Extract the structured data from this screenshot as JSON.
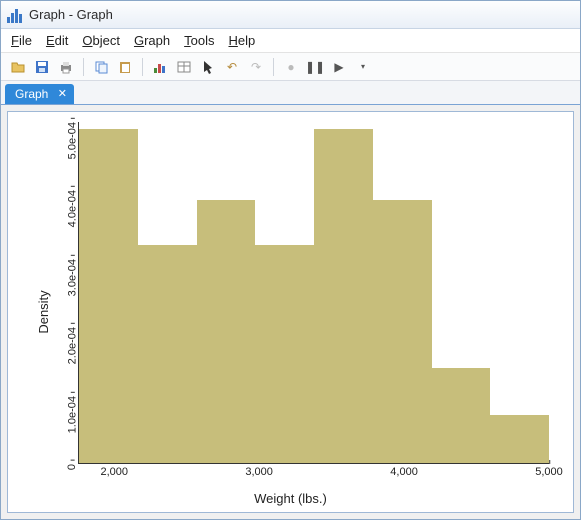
{
  "window": {
    "title": "Graph - Graph"
  },
  "menu": {
    "file": "File",
    "edit": "Edit",
    "object": "Object",
    "graph": "Graph",
    "tools": "Tools",
    "help": "Help"
  },
  "tab": {
    "label": "Graph"
  },
  "chart_data": {
    "type": "bar",
    "subtype": "histogram",
    "xlabel": "Weight (lbs.)",
    "ylabel": "Density",
    "bin_width": 500,
    "bin_edges": [
      1750,
      2250,
      2750,
      3250,
      3750,
      4250,
      4750,
      5250
    ],
    "categories": [
      "1750–2250",
      "2250–2750",
      "2750–3250",
      "3250–3750",
      "3750–4250",
      "4250–4750",
      "4750–5250"
    ],
    "values": [
      0.00049,
      0.00032,
      0.000385,
      0.00032,
      0.00049,
      0.000385,
      0.00014,
      7e-05
    ],
    "note_values_mapping": "values correspond to bin_edges lefts; 8 bars shown spanning the 7 edge pairs with extra leading bin at 1750",
    "ylim": [
      0,
      0.0005
    ],
    "yticks": [
      0,
      0.0001,
      0.0002,
      0.0003,
      0.0004,
      0.0005
    ],
    "ytick_labels": [
      "0",
      "1.0e-04",
      "2.0e-04",
      "3.0e-04",
      "4.0e-04",
      "5.0e-04"
    ],
    "xticks": [
      2000,
      3000,
      4000,
      5000
    ],
    "xtick_labels": [
      "2,000",
      "3,000",
      "4,000",
      "5,000"
    ],
    "xlim": [
      1750,
      5000
    ],
    "bar_color": "#c7be7b"
  }
}
